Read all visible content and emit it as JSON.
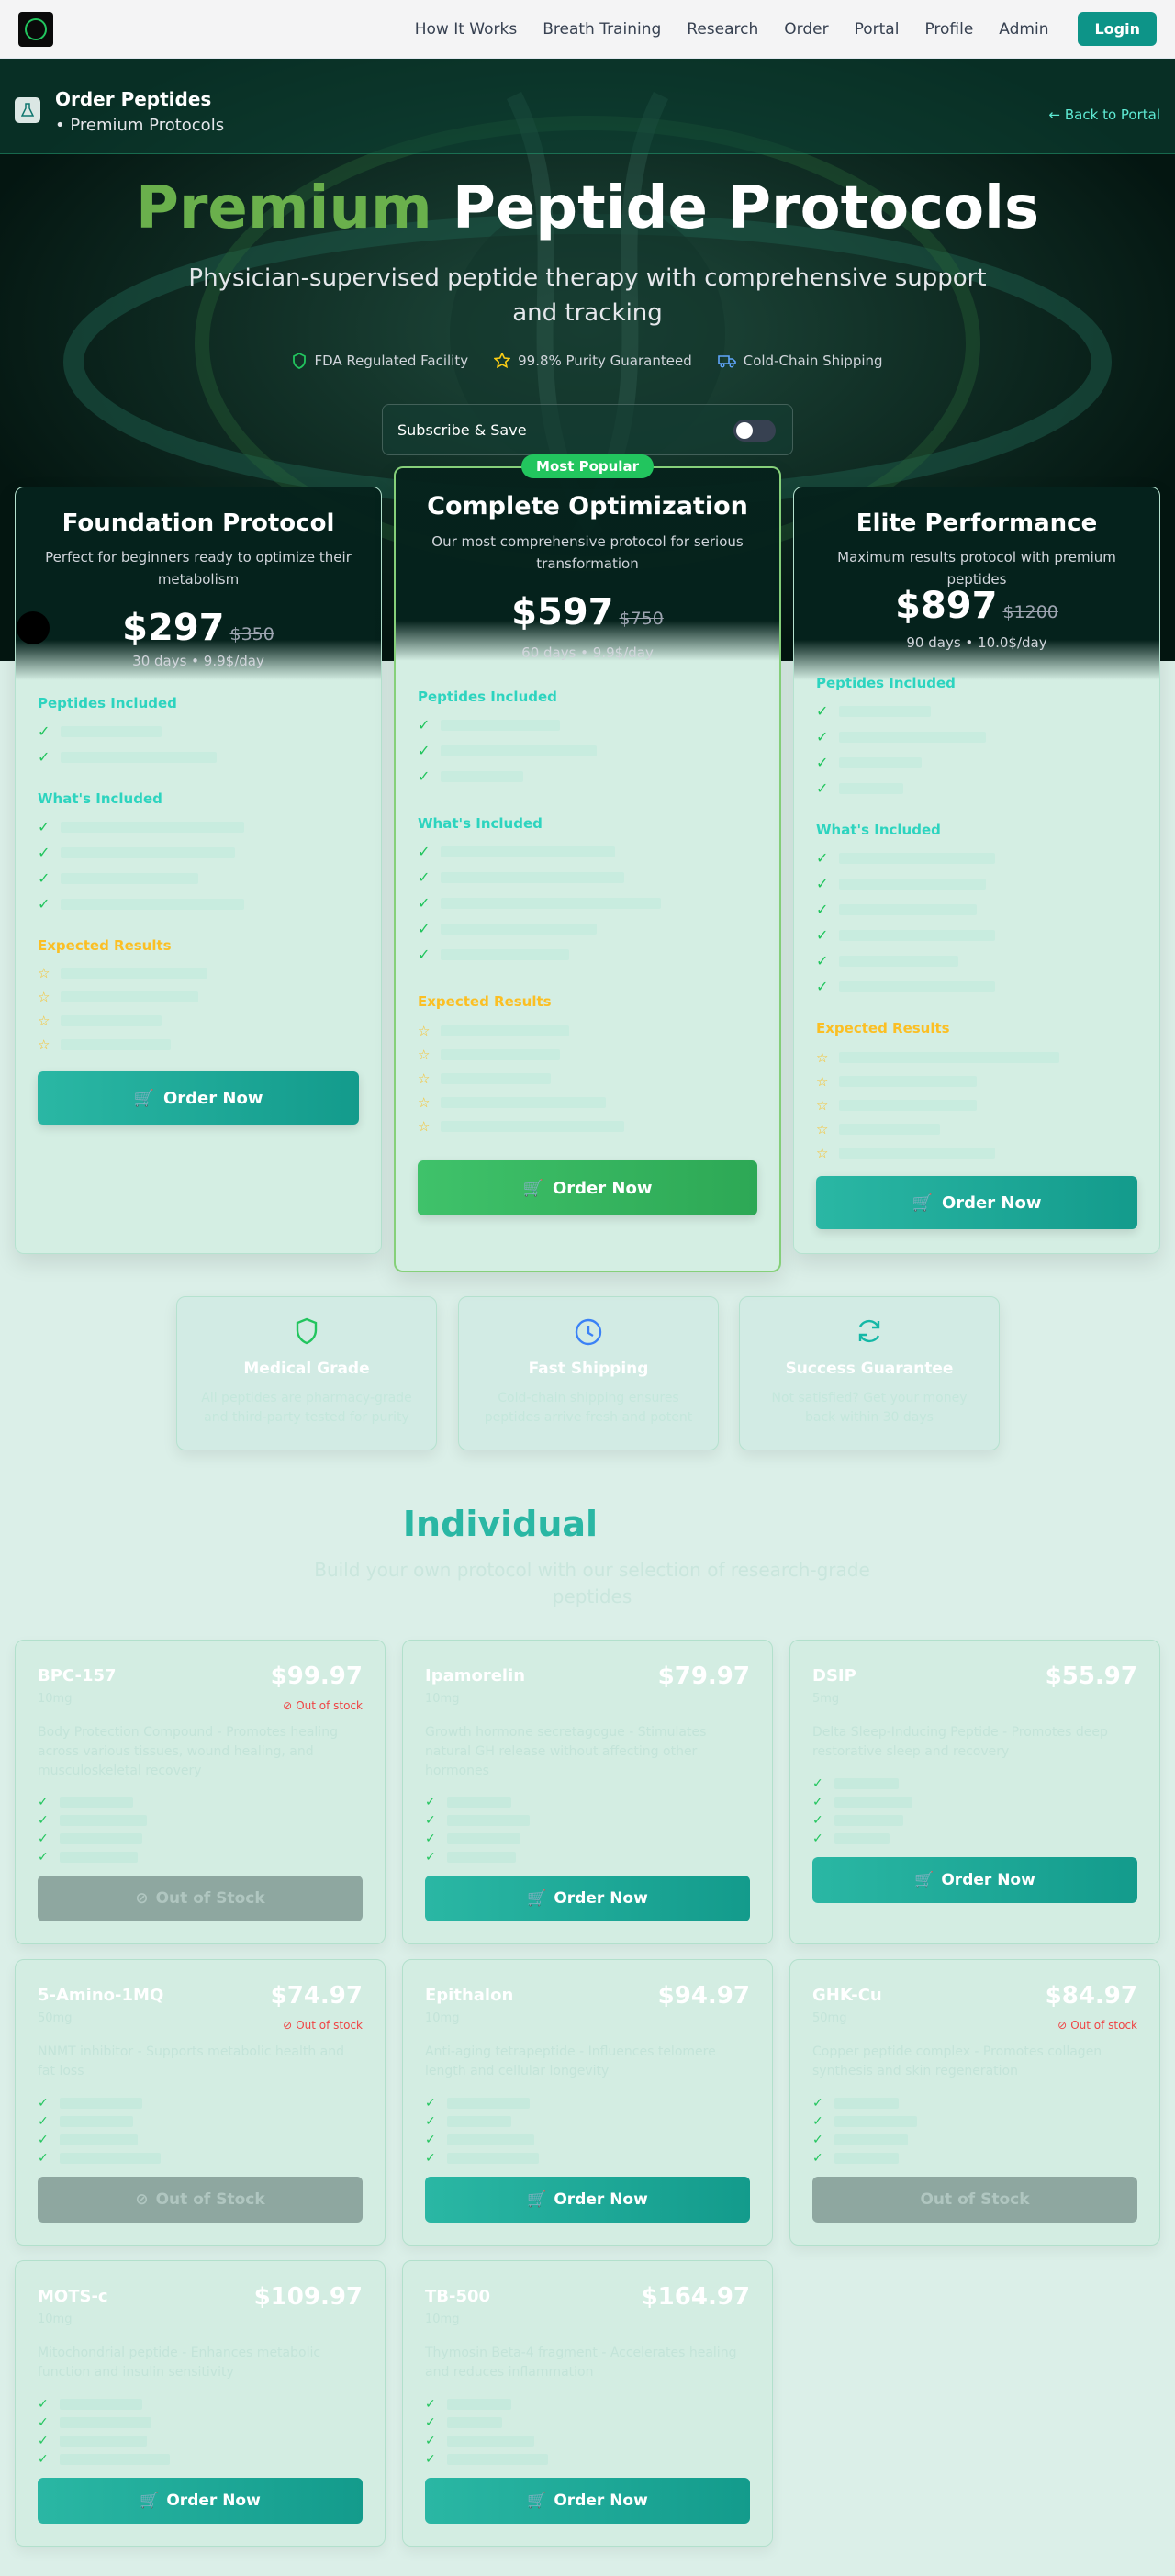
{
  "nav": {
    "links": [
      "How It Works",
      "Breath Training",
      "Research",
      "Order",
      "Portal",
      "Profile",
      "Admin"
    ],
    "login": "Login"
  },
  "subheader": {
    "title": "Order Peptides",
    "subtitle": "• Premium Protocols",
    "back": "← Back to Portal"
  },
  "hero": {
    "title_accent": "Premium",
    "title_rest": "Peptide Protocols",
    "subtitle": "Physician-supervised peptide therapy with comprehensive support and tracking",
    "badges": [
      "FDA Regulated Facility",
      "99.8% Purity Guaranteed",
      "Cold-Chain Shipping"
    ],
    "subscribe_label": "Subscribe & Save",
    "subscribe_on": false
  },
  "plans": [
    {
      "name": "Foundation Protocol",
      "desc": "Perfect for beginners ready to optimize their metabolism",
      "price": "$297",
      "old_price": "$350",
      "meta": "30 days • 9.9$/day",
      "peptides_heading": "Peptides Included",
      "included_heading": "What's Included",
      "results_heading": "Expected Results",
      "button": "Order Now"
    },
    {
      "badge": "Most Popular",
      "name": "Complete Optimization",
      "desc": "Our most comprehensive protocol for serious transformation",
      "price": "$597",
      "old_price": "$750",
      "meta": "60 days • 9.9$/day",
      "peptides_heading": "Peptides Included",
      "included_heading": "What's Included",
      "results_heading": "Expected Results",
      "button": "Order Now"
    },
    {
      "name": "Elite Performance",
      "desc": "Maximum results protocol with premium peptides",
      "price": "$897",
      "old_price": "$1200",
      "meta": "90 days • 10.0$/day",
      "peptides_heading": "Peptides Included",
      "included_heading": "What's Included",
      "results_heading": "Expected Results",
      "button": "Order Now"
    }
  ],
  "features": [
    {
      "icon": "shield-icon",
      "title": "Medical Grade",
      "desc": "All peptides are pharmacy-grade and third-party tested for purity",
      "color": "#22c55e"
    },
    {
      "icon": "clock-icon",
      "title": "Fast Shipping",
      "desc": "Cold-chain shipping ensures peptides arrive fresh and potent",
      "color": "#3b82f6"
    },
    {
      "icon": "refresh-icon",
      "title": "Success Guarantee",
      "desc": "Not satisfied? Get your money back within 30 days",
      "color": "#14b8a6"
    }
  ],
  "individual": {
    "title": "Individual",
    "subtitle": "Build your own protocol with our selection of research-grade peptides"
  },
  "products": [
    {
      "name": "BPC-157",
      "price": "$99.97",
      "dose": "10mg",
      "desc": "Body Protection Compound - Promotes healing across various tissues, wound healing, and musculoskeletal recovery",
      "stock": "Out of stock",
      "button": "Out of Stock"
    },
    {
      "name": "Ipamorelin",
      "price": "$79.97",
      "dose": "10mg",
      "desc": "Growth hormone secretagogue - Stimulates natural GH release without affecting other hormones",
      "button": "Order Now"
    },
    {
      "name": "DSIP",
      "price": "$55.97",
      "dose": "5mg",
      "desc": "Delta Sleep-Inducing Peptide - Promotes deep restorative sleep and recovery",
      "button": "Order Now"
    },
    {
      "name": "5-Amino-1MQ",
      "price": "$74.97",
      "dose": "50mg",
      "desc": "NNMT inhibitor - Supports metabolic health and fat loss",
      "stock": "Out of stock",
      "button": "Out of Stock"
    },
    {
      "name": "Epithalon",
      "price": "$94.97",
      "dose": "10mg",
      "desc": "Anti-aging tetrapeptide - Influences telomere length and cellular longevity",
      "button": "Order Now"
    },
    {
      "name": "GHK-Cu",
      "price": "$84.97",
      "dose": "50mg",
      "desc": "Copper peptide complex - Promotes collagen synthesis and skin regeneration",
      "stock": "Out of stock",
      "button": "Out of Stock"
    },
    {
      "name": "MOTS-c",
      "price": "$109.97",
      "dose": "10mg",
      "desc": "Mitochondrial peptide - Enhances metabolic function and insulin sensitivity",
      "button": "Order Now"
    },
    {
      "name": "TB-500",
      "price": "$164.97",
      "dose": "10mg",
      "desc": "Thymosin Beta-4 fragment - Accelerates healing and reduces inflammation",
      "button": "Order Now"
    }
  ]
}
